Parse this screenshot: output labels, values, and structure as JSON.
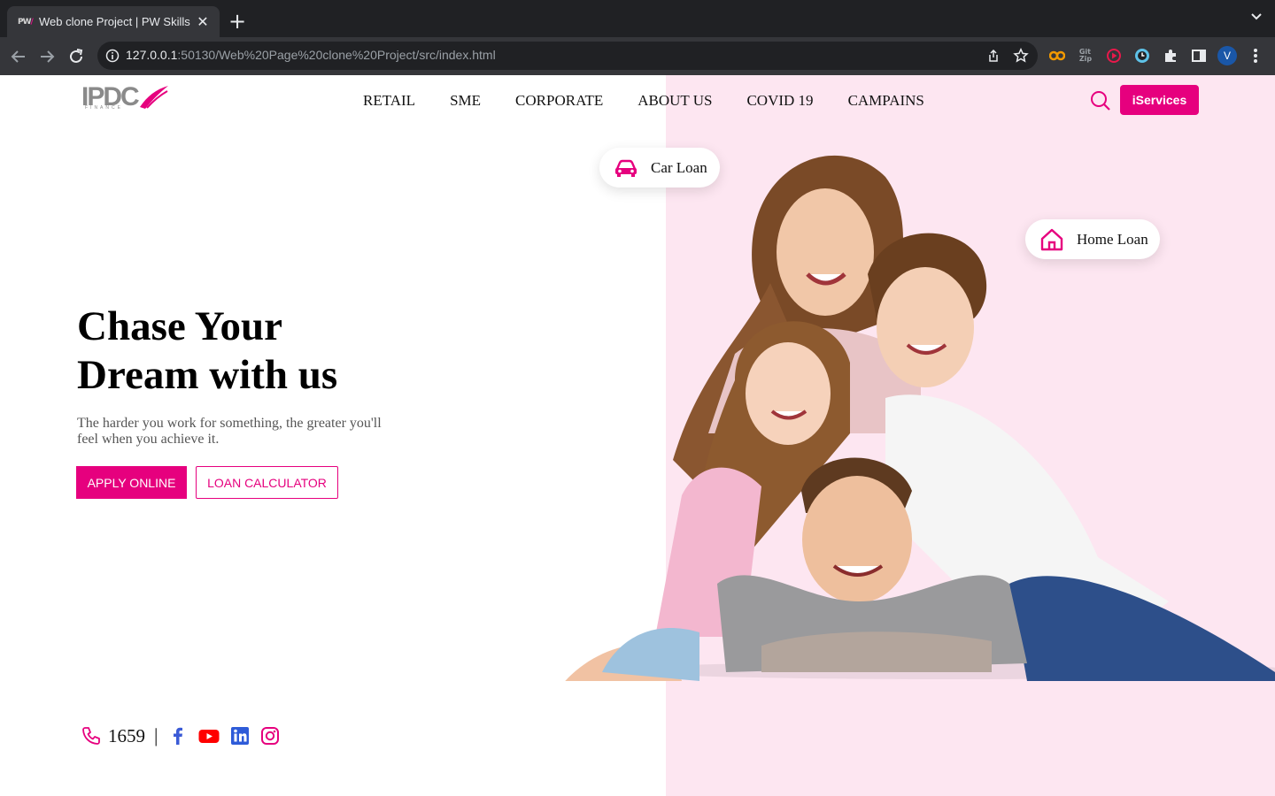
{
  "browser": {
    "tab_title": "Web clone Project | PW Skills",
    "favicon_text": "PW",
    "url_host": "127.0.0.1",
    "url_rest": ":50130/Web%20Page%20clone%20Project/src/index.html",
    "profile_initial": "V"
  },
  "site": {
    "logo_text": "IPDC",
    "logo_sub": "FINANCE",
    "nav": [
      "RETAIL",
      "SME",
      "CORPORATE",
      "ABOUT US",
      "COVID 19",
      "CAMPAINS"
    ],
    "iservices_label": "iServices",
    "accent": "#e6007e",
    "panel_color": "#fde6f1"
  },
  "hero": {
    "title_line1": "Chase Your",
    "title_line2": "Dream with us",
    "subtitle": "The harder you work for something, the greater you'll feel when you achieve it.",
    "apply_label": "APPLY ONLINE",
    "calculator_label": "LOAN CALCULATOR"
  },
  "badges": {
    "car_loan": "Car Loan",
    "home_loan": "Home Loan"
  },
  "contact": {
    "hotline": "1659",
    "separator": "|",
    "social": [
      "facebook-icon",
      "youtube-icon",
      "linkedin-icon",
      "instagram-icon"
    ]
  }
}
